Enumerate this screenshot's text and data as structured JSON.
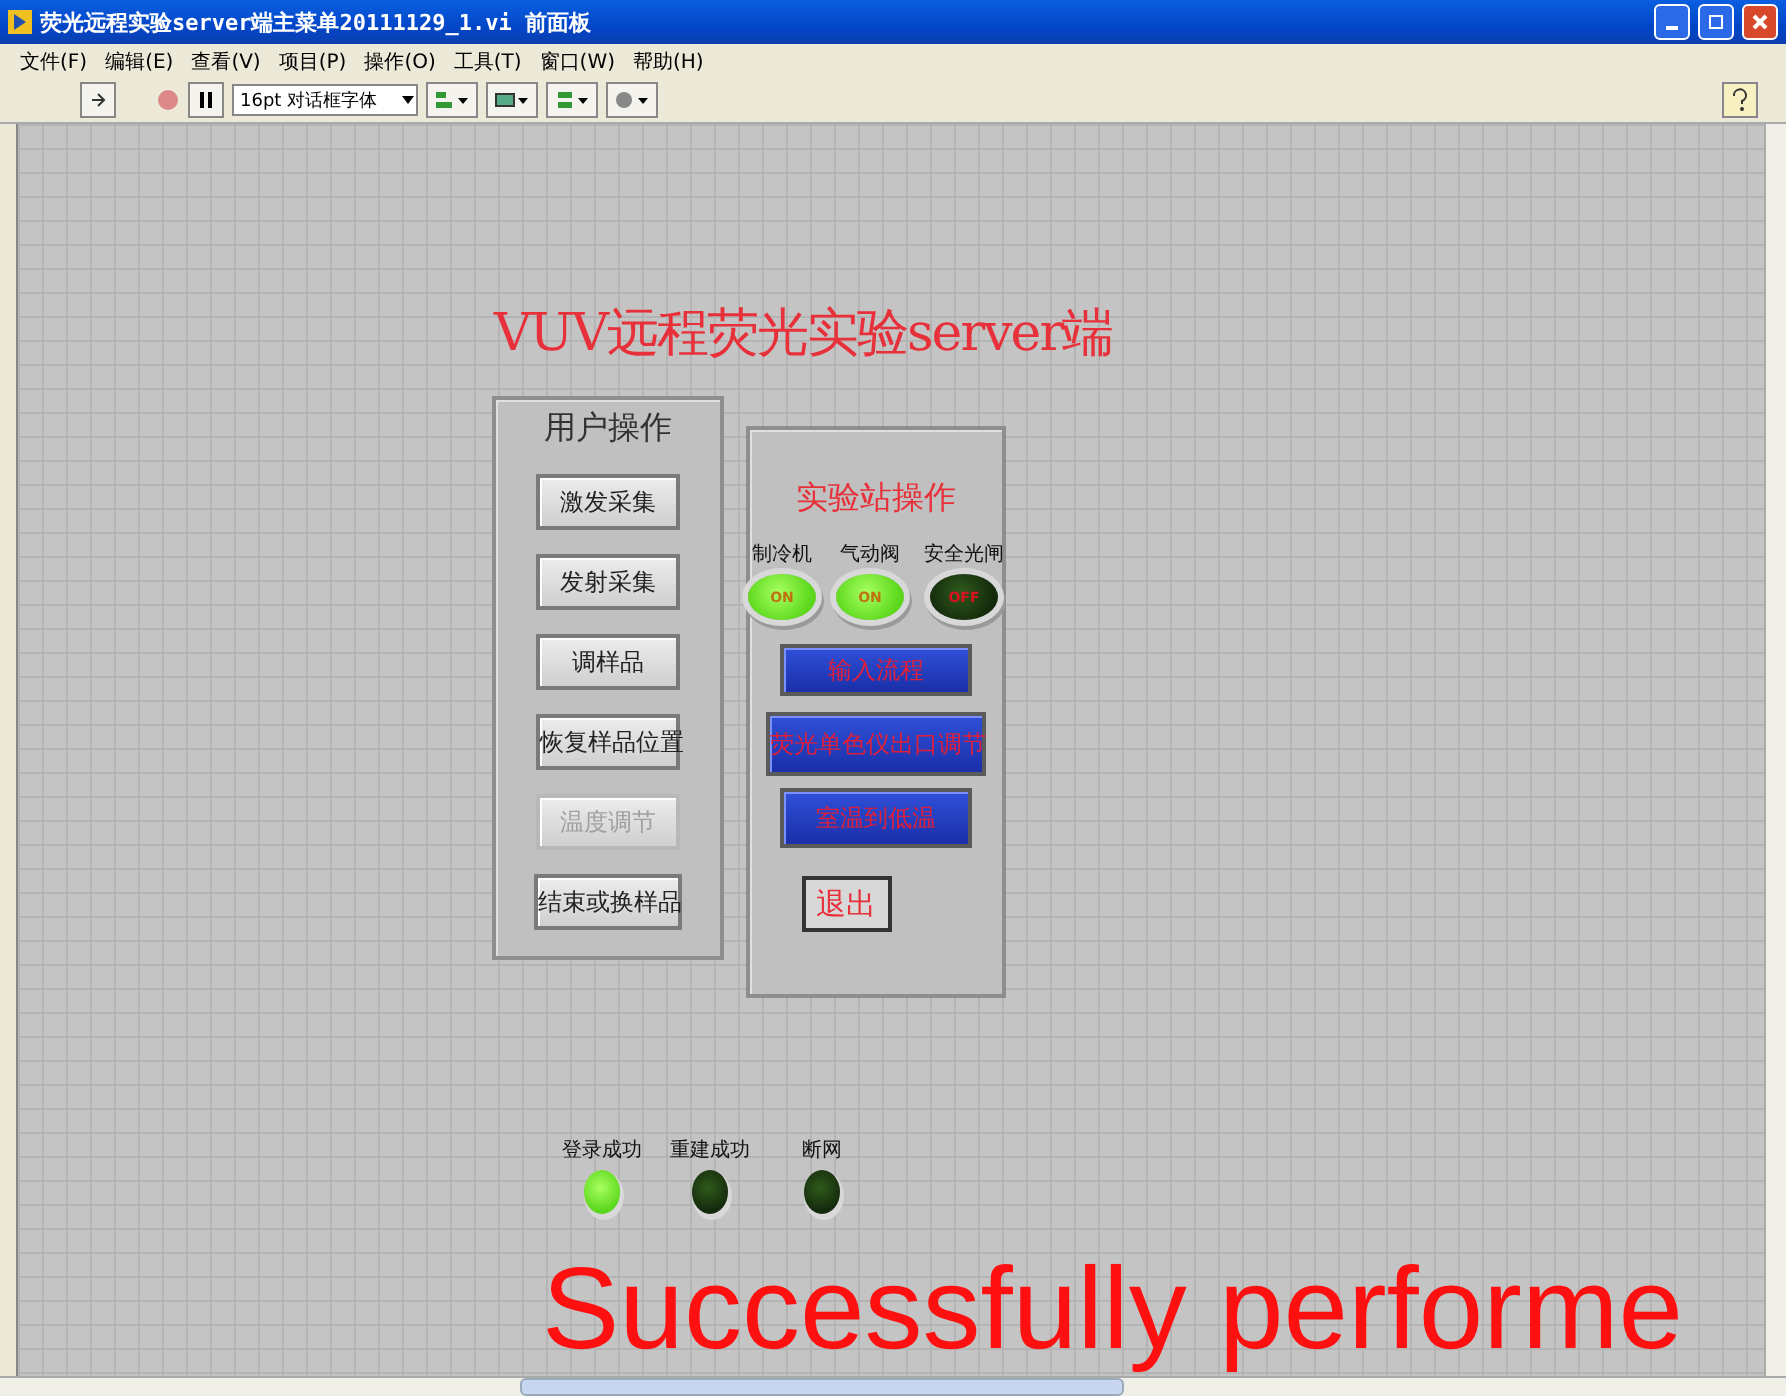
{
  "window": {
    "title": "荧光远程实验server端主菜单20111129_1.vi 前面板"
  },
  "menu": [
    "文件(F)",
    "编辑(E)",
    "查看(V)",
    "项目(P)",
    "操作(O)",
    "工具(T)",
    "窗口(W)",
    "帮助(H)"
  ],
  "toolbar": {
    "font_selector": "16pt 对话框字体"
  },
  "panel": {
    "heading": "VUV远程荧光实验server端",
    "user_ops": {
      "title": "用户操作",
      "buttons": [
        {
          "label": "激发采集",
          "disabled": false
        },
        {
          "label": "发射采集",
          "disabled": false
        },
        {
          "label": "调样品",
          "disabled": false
        },
        {
          "label": "恢复样品位置",
          "disabled": false
        },
        {
          "label": "温度调节",
          "disabled": true
        },
        {
          "label": "结束或换样品",
          "disabled": false
        }
      ]
    },
    "station_ops": {
      "title": "实验站操作",
      "indicators": [
        {
          "label": "制冷机",
          "on": true,
          "text": "ON"
        },
        {
          "label": "气动阀",
          "on": true,
          "text": "ON"
        },
        {
          "label": "安全光闸",
          "on": false,
          "text": "OFF"
        }
      ],
      "buttons": [
        "输入流程",
        "荧光单色仪出口调节",
        "室温到低温"
      ],
      "exit": "退出"
    },
    "status_leds": [
      {
        "label": "登录成功",
        "on": true
      },
      {
        "label": "重建成功",
        "on": false
      },
      {
        "label": "断网",
        "on": false
      }
    ]
  },
  "overlay_text": "Successfully performe"
}
